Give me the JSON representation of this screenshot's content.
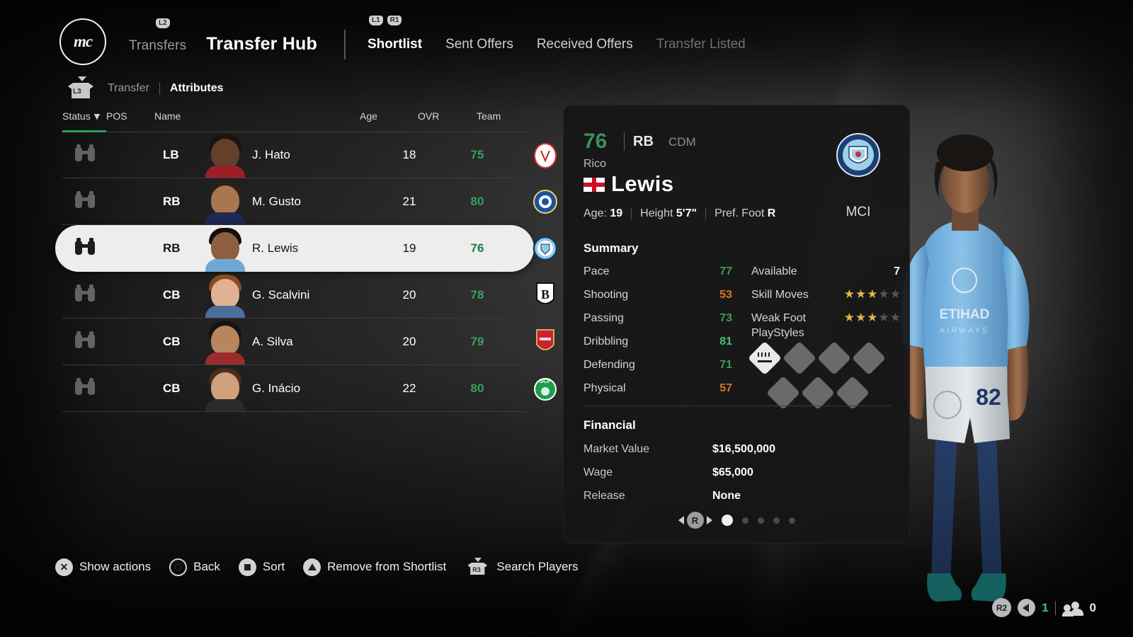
{
  "header": {
    "club_badge_text": "mc",
    "l2_badge": "L2",
    "l1_badge": "L1",
    "r1_badge": "R1",
    "breadcrumb_parent": "Transfers",
    "page_title": "Transfer Hub",
    "tabs": [
      {
        "label": "Shortlist",
        "state": "active"
      },
      {
        "label": "Sent Offers",
        "state": "normal"
      },
      {
        "label": "Received Offers",
        "state": "normal"
      },
      {
        "label": "Transfer Listed",
        "state": "disabled"
      }
    ]
  },
  "subnav": {
    "l3_badge": "L3",
    "items": [
      {
        "label": "Transfer",
        "state": "normal"
      },
      {
        "label": "Attributes",
        "state": "active"
      }
    ]
  },
  "list": {
    "columns": [
      "Status",
      "POS",
      "Name",
      "Age",
      "OVR",
      "Team"
    ],
    "sort_column": "Status",
    "sort_arrow": "▼",
    "rows": [
      {
        "pos": "LB",
        "name": "J. Hato",
        "age": "18",
        "ovr": "75",
        "team": "AJA",
        "selected": false
      },
      {
        "pos": "RB",
        "name": "M. Gusto",
        "age": "21",
        "ovr": "80",
        "team": "CHE",
        "selected": false
      },
      {
        "pos": "RB",
        "name": "R. Lewis",
        "age": "19",
        "ovr": "76",
        "team": "MCI",
        "selected": true
      },
      {
        "pos": "CB",
        "name": "G. Scalvini",
        "age": "20",
        "ovr": "78",
        "team": "ATA",
        "selected": false
      },
      {
        "pos": "CB",
        "name": "A. Silva",
        "age": "20",
        "ovr": "79",
        "team": "ARS",
        "selected": false
      },
      {
        "pos": "CB",
        "name": "G. Inácio",
        "age": "22",
        "ovr": "80",
        "team": "SCP",
        "selected": false
      }
    ]
  },
  "detail": {
    "overall": "76",
    "position": "RB",
    "alt_position": "CDM",
    "first_name": "Rico",
    "last_name": "Lewis",
    "nationality": "England",
    "age_label": "Age:",
    "age_value": "19",
    "height_label": "Height",
    "height_value": "5'7\"",
    "foot_label": "Pref. Foot",
    "foot_value": "R",
    "club_short": "MCI",
    "summary": {
      "title": "Summary",
      "stats": [
        {
          "label": "Pace",
          "value": "77",
          "tone": "green"
        },
        {
          "label": "Shooting",
          "value": "53",
          "tone": "orange"
        },
        {
          "label": "Passing",
          "value": "73",
          "tone": "green"
        },
        {
          "label": "Dribbling",
          "value": "81",
          "tone": "bright-green"
        },
        {
          "label": "Defending",
          "value": "71",
          "tone": "green"
        },
        {
          "label": "Physical",
          "value": "57",
          "tone": "orange"
        }
      ],
      "available_label": "Available",
      "available_value": "7",
      "skill_moves_label": "Skill Moves",
      "skill_moves": 3,
      "weak_foot_label": "Weak Foot",
      "weak_foot": 3,
      "stars_max": 5,
      "playstyles_label": "PlayStyles",
      "playstyles_filled": 1,
      "playstyles_row1_total": 4,
      "playstyles_row2_total": 3
    },
    "financial": {
      "title": "Financial",
      "rows": [
        {
          "label": "Market Value",
          "value": "$16,500,000"
        },
        {
          "label": "Wage",
          "value": "$65,000"
        },
        {
          "label": "Release",
          "value": "None"
        }
      ]
    },
    "pager": {
      "stick": "R",
      "total_dots": 5,
      "active_index": 0
    }
  },
  "render": {
    "jersey_number": "82",
    "kit_sponsor": "ETIHAD",
    "kit_sponsor_sub": "AIRWAYS"
  },
  "bottom_bar": [
    {
      "button": "cross",
      "glyph": "✕",
      "label": "Show actions"
    },
    {
      "button": "circle",
      "glyph": "",
      "label": "Back"
    },
    {
      "button": "square",
      "glyph": "",
      "label": "Sort"
    },
    {
      "button": "triangle",
      "glyph": "",
      "label": "Remove from Shortlist"
    },
    {
      "button": "r3-stick",
      "glyph": "R3",
      "label": "Search Players"
    }
  ],
  "status_bar": {
    "r2_badge": "R2",
    "voice_count": "1",
    "people_count": "0"
  },
  "colors": {
    "accent_green": "#3f9b61",
    "accent_orange": "#d0782c",
    "sort_underline": "#2f9e5a",
    "selected_row_bg": "#ededed",
    "star_gold": "#e0b64a"
  }
}
